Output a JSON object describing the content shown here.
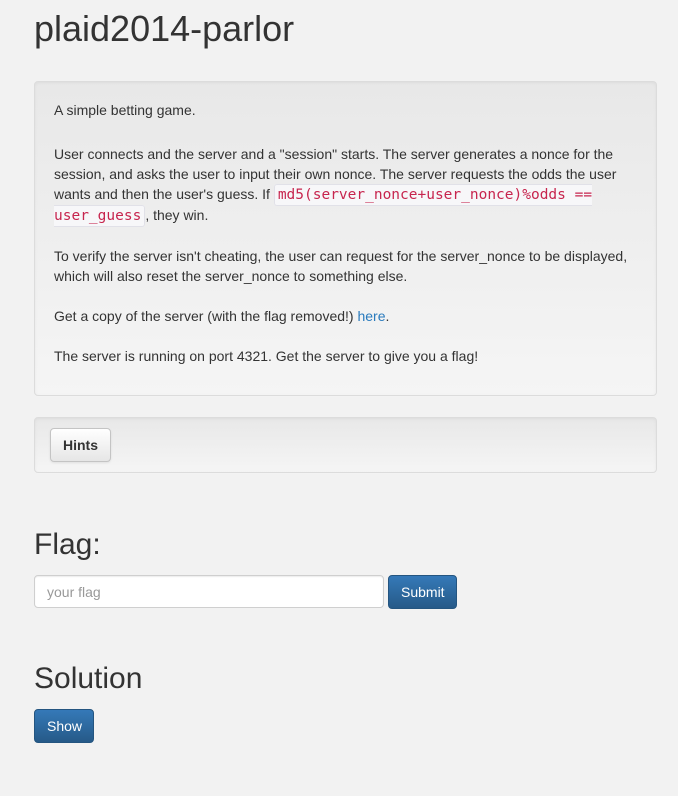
{
  "page": {
    "title": "plaid2014-parlor"
  },
  "description": {
    "intro": "A simple betting game.",
    "para2_before": "User connects and the server and a \"session\" starts. The server generates a nonce for the session, and asks the user to input their own nonce. The server requests the odds the user wants and then the user's guess. If ",
    "para2_code": "md5(server_nonce+user_nonce)%odds == user_guess",
    "para2_after": ", they win.",
    "para3": "To verify the server isn't cheating, the user can request for the server_nonce to be displayed, which will also reset the server_nonce to something else.",
    "para4_before": "Get a copy of the server (with the flag removed!) ",
    "para4_link": "here",
    "para4_after": ".",
    "para5": "The server is running on port 4321. Get the server to give you a flag!"
  },
  "hints": {
    "button_label": "Hints"
  },
  "flag": {
    "heading": "Flag:",
    "input_placeholder": "your flag",
    "input_value": "",
    "submit_label": "Submit"
  },
  "solution": {
    "heading": "Solution",
    "show_label": "Show"
  },
  "colors": {
    "primary": "#2e6da4",
    "link": "#2a7bbd",
    "code": "#c7254e",
    "background": "#f2f2f2"
  }
}
